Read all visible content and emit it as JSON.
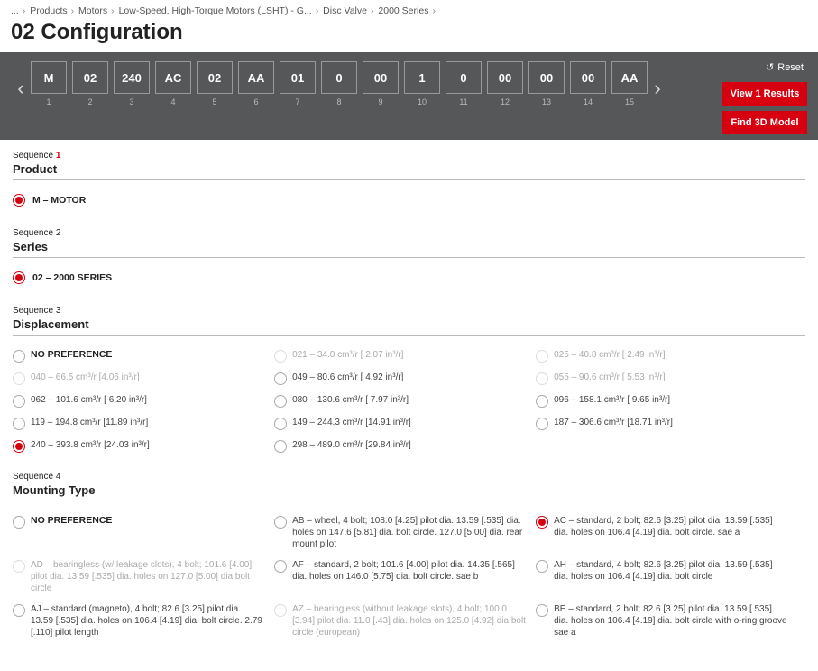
{
  "breadcrumb": [
    "...",
    "Products",
    "Motors",
    "Low-Speed, High-Torque Motors (LSHT) - G...",
    "Disc Valve",
    "2000 Series"
  ],
  "title": "02 Configuration",
  "reset_label": "Reset",
  "view_results_label": "View 1 Results",
  "find_3d_label": "Find 3D Model",
  "slots": [
    {
      "v": "M",
      "n": "1"
    },
    {
      "v": "02",
      "n": "2"
    },
    {
      "v": "240",
      "n": "3"
    },
    {
      "v": "AC",
      "n": "4"
    },
    {
      "v": "02",
      "n": "5"
    },
    {
      "v": "AA",
      "n": "6"
    },
    {
      "v": "01",
      "n": "7"
    },
    {
      "v": "0",
      "n": "8"
    },
    {
      "v": "00",
      "n": "9"
    },
    {
      "v": "1",
      "n": "10"
    },
    {
      "v": "0",
      "n": "11"
    },
    {
      "v": "00",
      "n": "12"
    },
    {
      "v": "00",
      "n": "13"
    },
    {
      "v": "00",
      "n": "14"
    },
    {
      "v": "AA",
      "n": "15"
    }
  ],
  "seq1": {
    "label_pre": "Sequence ",
    "label_num": "1",
    "title": "Product",
    "opt": "M – MOTOR"
  },
  "seq2": {
    "label_pre": "Sequence ",
    "label_num": "2",
    "title": "Series",
    "opt": "02 – 2000 SERIES"
  },
  "seq3": {
    "label_pre": "Sequence ",
    "label_num": "3",
    "title": "Displacement",
    "no_pref": "NO PREFERENCE",
    "options": [
      {
        "text": "021 – 34.0 cm³/r [ 2.07 in³/r]",
        "disabled": true
      },
      {
        "text": "025 – 40.8 cm³/r [ 2.49 in³/r]",
        "disabled": true
      },
      {
        "text": "040 – 66.5 cm³/r [4.06 in³/r]",
        "disabled": true
      },
      {
        "text": "049 – 80.6 cm³/r [ 4.92 in³/r]"
      },
      {
        "text": "055 – 90.6 cm³/r [ 5.53 in³/r]",
        "disabled": true
      },
      {
        "text": "062 – 101.6 cm³/r [ 6.20 in³/r]"
      },
      {
        "text": "080 – 130.6 cm³/r [ 7.97 in³/r]"
      },
      {
        "text": "096 – 158.1 cm³/r [ 9.65 in³/r]"
      },
      {
        "text": "119 – 194.8 cm³/r [11.89 in³/r]"
      },
      {
        "text": "149 – 244.3 cm³/r [14.91 in³/r]"
      },
      {
        "text": "187 – 306.6 cm³/r [18.71 in³/r]"
      },
      {
        "text": "240 – 393.8 cm³/r [24.03 in³/r]",
        "checked": true
      },
      {
        "text": "298 – 489.0 cm³/r [29.84 in³/r]"
      }
    ]
  },
  "seq4": {
    "label_pre": "Sequence ",
    "label_num": "4",
    "title": "Mounting Type",
    "no_pref": "NO PREFERENCE",
    "options": [
      {
        "text": "AB – wheel, 4 bolt; 108.0 [4.25] pilot dia. 13.59 [.535] dia. holes on 147.6 [5.81] dia. bolt circle. 127.0 [5.00] dia. rear mount pilot"
      },
      {
        "text": "AC – standard, 2 bolt; 82.6 [3.25] pilot dia. 13.59 [.535] dia. holes on 106.4 [4.19] dia. bolt circle. sae a",
        "checked": true
      },
      {
        "text": "AD – bearingless (w/ leakage slots), 4 bolt; 101.6 [4.00] pilot dia. 13.59 [.535] dia. holes on 127.0 [5.00] dia bolt circle",
        "disabled": true
      },
      {
        "text": "AF – standard, 2 bolt; 101.6 [4.00] pilot dia. 14.35 [.565] dia. holes on 146.0 [5.75] dia. bolt circle. sae b"
      },
      {
        "text": "AH – standard, 4 bolt; 82.6 [3.25] pilot dia. 13.59 [.535] dia. holes on 106.4 [4.19] dia. bolt circle"
      },
      {
        "text": "AJ – standard (magneto), 4 bolt; 82.6 [3.25] pilot dia. 13.59 [.535] dia. holes on 106.4 [4.19] dia. bolt circle. 2.79 [.110] pilot length"
      },
      {
        "text": "AZ – bearingless (without leakage slots), 4 bolt; 100.0 [3.94] pilot dia. 11.0 [.43] dia. holes on 125.0 [4.92] dia bolt circle (european)",
        "disabled": true
      },
      {
        "text": "BE – standard, 2 bolt; 82.6 [3.25] pilot dia. 13.59 [.535] dia. holes on 106.4 [4.19] dia. bolt circle with o-ring groove sae a"
      }
    ]
  }
}
